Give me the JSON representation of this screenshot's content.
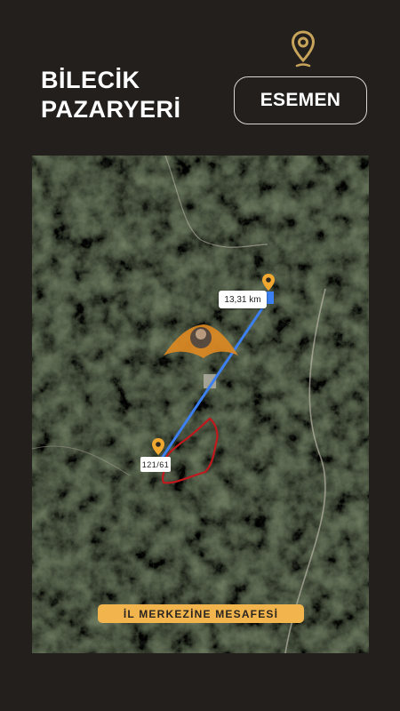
{
  "header": {
    "title_line1": "BİLECİK",
    "title_line2": "PAZARYERİ",
    "location_button": "ESEMEN",
    "pin_icon": "map-pin-icon"
  },
  "map": {
    "distance_label": "13,31 km",
    "parcel_label": "121/61",
    "banner_text": "İL MERKEZİNE MESAFESİ",
    "route_color": "#3b7ff0",
    "parcel_color": "#c0181c",
    "pin_color": "#f0a830"
  },
  "colors": {
    "background": "#221f1d",
    "accent": "#c8a35a",
    "banner": "#f2b44c"
  }
}
